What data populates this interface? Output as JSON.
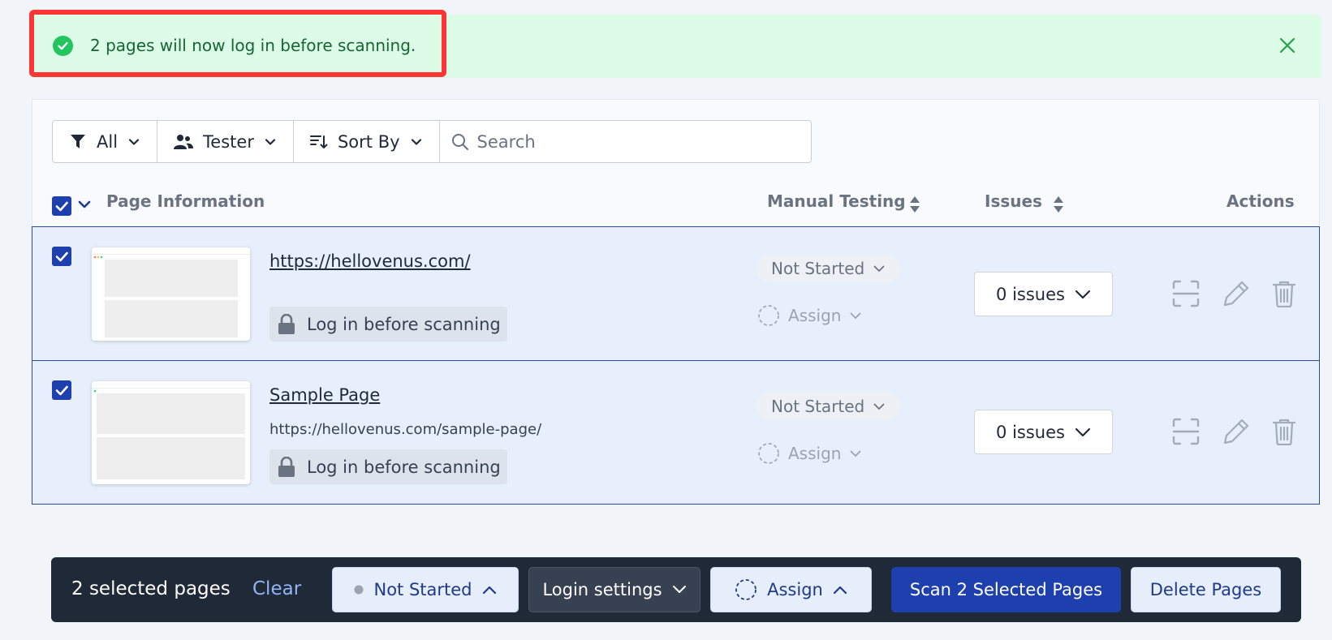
{
  "banner": {
    "message": "2 pages will now log in before scanning.",
    "icon": "check-circle-icon",
    "close_icon": "close-icon",
    "accent": "#22c55e"
  },
  "filters": {
    "all_label": "All",
    "tester_label": "Tester",
    "sort_label": "Sort By",
    "search_placeholder": "Search"
  },
  "table": {
    "headers": {
      "page_info": "Page Information",
      "manual_testing": "Manual Testing",
      "issues": "Issues",
      "actions": "Actions"
    },
    "rows": [
      {
        "selected": true,
        "title": "https://hellovenus.com/",
        "url": "",
        "login_label": "Log in before scanning",
        "status": "Not Started",
        "assign": "Assign",
        "issues": "0 issues"
      },
      {
        "selected": true,
        "title": "Sample Page",
        "url": "https://hellovenus.com/sample-page/",
        "login_label": "Log in before scanning",
        "status": "Not Started",
        "assign": "Assign",
        "issues": "0 issues"
      }
    ]
  },
  "bulk_bar": {
    "count_text": "2 selected pages",
    "clear_label": "Clear",
    "status_label": "Not Started",
    "login_settings_label": "Login settings",
    "assign_label": "Assign",
    "scan_label": "Scan 2 Selected Pages",
    "delete_label": "Delete Pages"
  },
  "colors": {
    "primary": "#1e40af",
    "row_bg": "#e6effb",
    "banner_bg": "#dcfce7",
    "highlight": "#ff3434"
  }
}
